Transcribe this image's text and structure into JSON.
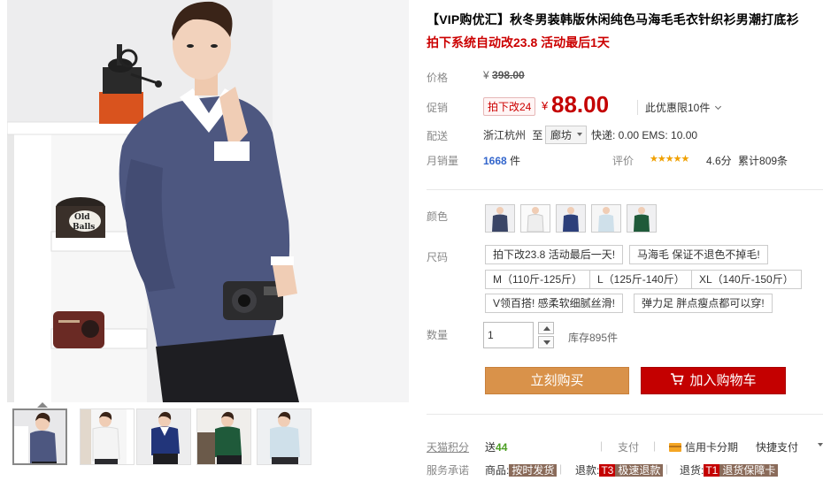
{
  "product": {
    "title": "【VIP购优汇】秋冬男装韩版休闲纯色马海毛毛衣针织衫男潮打底衫",
    "subtitle": "拍下系统自动改23.8 活动最后1天"
  },
  "labels": {
    "price": "价格",
    "promo": "促销",
    "delivery": "配送",
    "monthly_sales": "月销量",
    "rating": "评价",
    "color": "颜色",
    "size": "尺码",
    "quantity": "数量",
    "tmall_points": "天猫积分",
    "payment": "支付",
    "service": "服务承诺"
  },
  "price": {
    "currency": "¥",
    "original": "398.00",
    "promo_tag": "拍下改24",
    "current": "88.00",
    "limit_text": "此优惠限10件"
  },
  "delivery": {
    "from": "浙江杭州",
    "to_word": "至",
    "to_city": "廊坊",
    "fees": "快递: 0.00 EMS: 10.00"
  },
  "sales": {
    "count": "1668",
    "unit": "件",
    "stars": "★★★★★",
    "score": "4.6分",
    "reviews": "累计809条"
  },
  "colors": [
    "#3a4566",
    "#f2f2f2",
    "#2c3f7a",
    "#cfe0ea",
    "#1f5a3a"
  ],
  "sizes": [
    "拍下改23.8 活动最后一天!",
    "马海毛 保证不退色不掉毛!",
    "M（110斤-125斤）",
    "L（125斤-140斤）",
    "XL（140斤-150斤）",
    "V领百搭! 感柔软细腻丝滑!",
    "弹力足 胖点瘦点都可以穿!"
  ],
  "quantity": {
    "value": "1",
    "stock": "库存895件"
  },
  "buttons": {
    "buy_now": "立刻购买",
    "add_to_cart": "加入购物车"
  },
  "bottom": {
    "points_prefix": "送",
    "points_value": "44",
    "sep": "|",
    "credit": "信用卡分期",
    "quick_pay": "快捷支付",
    "goods_label": "商品:",
    "goods_tag": "按时发货",
    "refund_label": "退款:",
    "refund_code": "T3",
    "refund_tag": "极速退款",
    "return_label": "退货:",
    "return_code": "T1",
    "return_tag": "退货保障卡"
  },
  "photo_sign_text": "Old Balls"
}
